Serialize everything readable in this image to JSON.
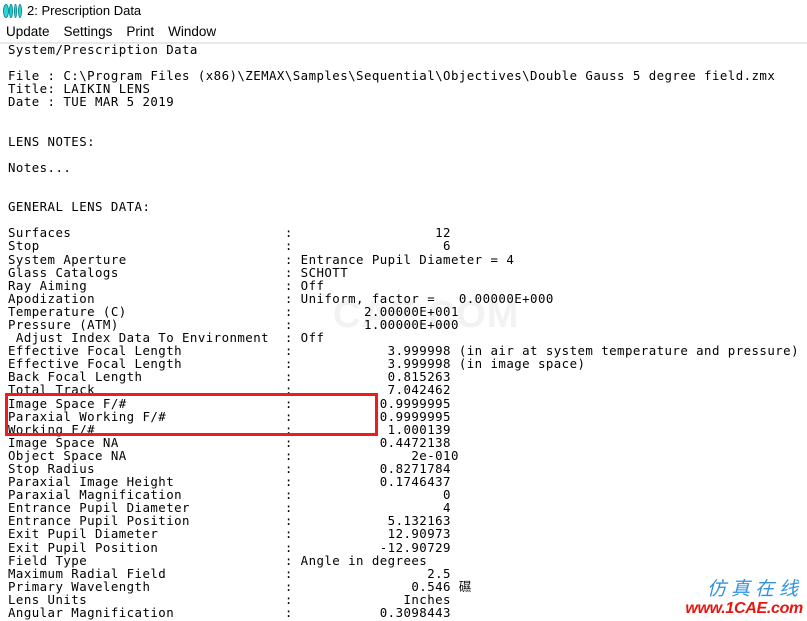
{
  "window": {
    "icon": "lens-doublet-icon",
    "title": "2: Prescription Data"
  },
  "menu": {
    "items": [
      {
        "label": "Update"
      },
      {
        "label": "Settings"
      },
      {
        "label": "Print"
      },
      {
        "label": "Window"
      }
    ]
  },
  "report": {
    "heading": "System/Prescription Data",
    "file_label": "File :",
    "file_value": "C:\\Program Files (x86)\\ZEMAX\\Samples\\Sequential\\Objectives\\Double Gauss 5 degree field.zmx",
    "title_label": "Title:",
    "title_value": "LAIKIN LENS",
    "date_label": "Date :",
    "date_value": "TUE MAR 5 2019",
    "notes_heading": "LENS NOTES:",
    "notes_value": "Notes...",
    "general_heading": "GENERAL LENS DATA:",
    "rows": [
      {
        "label": "Surfaces",
        "value": "                  12"
      },
      {
        "label": "Stop",
        "value": "                   6"
      },
      {
        "label": "System Aperture",
        "value": " Entrance Pupil Diameter = 4"
      },
      {
        "label": "Glass Catalogs",
        "value": " SCHOTT"
      },
      {
        "label": "Ray Aiming",
        "value": " Off"
      },
      {
        "label": "Apodization",
        "value": " Uniform, factor =   0.00000E+000"
      },
      {
        "label": "Temperature (C)",
        "value": "         2.00000E+001"
      },
      {
        "label": "Pressure (ATM)",
        "value": "         1.00000E+000"
      },
      {
        "label": " Adjust Index Data To Environment",
        "value": " Off",
        "nocolonpad": true
      },
      {
        "label": "Effective Focal Length",
        "value": "            3.999998 (in air at system temperature and pressure)"
      },
      {
        "label": "Effective Focal Length",
        "value": "            3.999998 (in image space)"
      },
      {
        "label": "Back Focal Length",
        "value": "            0.815263"
      },
      {
        "label": "Total Track",
        "value": "            7.042462"
      },
      {
        "label": "Image Space F/#",
        "value": "           0.9999995"
      },
      {
        "label": "Paraxial Working F/#",
        "value": "           0.9999995"
      },
      {
        "label": "Working F/#",
        "value": "            1.000139"
      },
      {
        "label": "Image Space NA",
        "value": "           0.4472138"
      },
      {
        "label": "Object Space NA",
        "value": "               2e-010"
      },
      {
        "label": "Stop Radius",
        "value": "           0.8271784"
      },
      {
        "label": "Paraxial Image Height",
        "value": "           0.1746437"
      },
      {
        "label": "Paraxial Magnification",
        "value": "                   0"
      },
      {
        "label": "Entrance Pupil Diameter",
        "value": "                   4"
      },
      {
        "label": "Entrance Pupil Position",
        "value": "            5.132163"
      },
      {
        "label": "Exit Pupil Diameter",
        "value": "            12.90973"
      },
      {
        "label": "Exit Pupil Position",
        "value": "           -12.90729"
      },
      {
        "label": "Field Type",
        "value": " Angle in degrees"
      },
      {
        "label": "Maximum Radial Field",
        "value": "                 2.5"
      },
      {
        "label": "Primary Wavelength",
        "value": "               0.546 礘"
      },
      {
        "label": "Lens Units",
        "value": "              Inches"
      },
      {
        "label": "Angular Magnification",
        "value": "           0.3098443"
      }
    ]
  },
  "highlight": {
    "color": "#ee1c1c",
    "rows": [
      "Image Space F/#",
      "Paraxial Working F/#",
      "Working F/#"
    ]
  },
  "watermarks": {
    "background_text": "CAE.COM",
    "background_color": "#f2f2f2",
    "footer_cn": "仿真在线",
    "footer_cn_color": "#2f93e0",
    "footer_url": "www.1CAE.com",
    "footer_url_color": "#e8150f"
  }
}
